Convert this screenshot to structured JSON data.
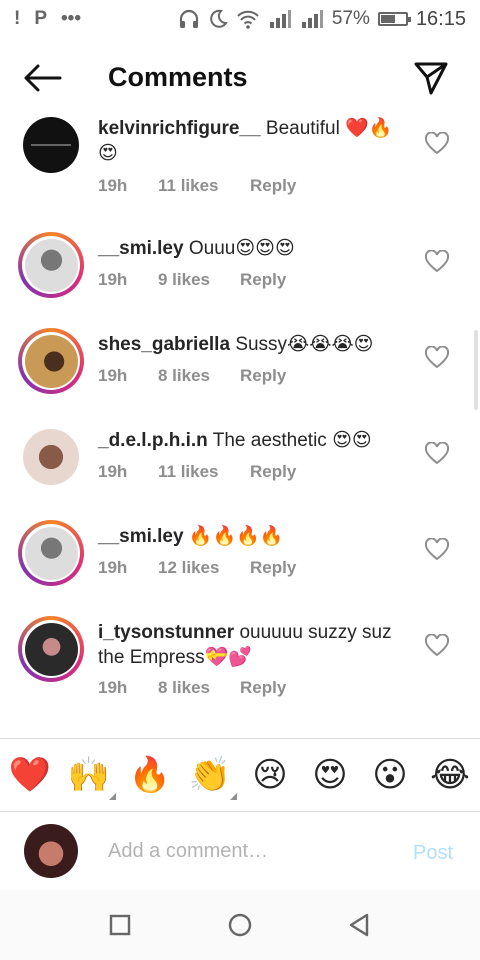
{
  "status_bar": {
    "left_glyphs": [
      "!",
      "P",
      "•••"
    ],
    "battery_percent": "57%",
    "battery_level": 0.57,
    "time": "16:15",
    "icons": [
      "headphones-icon",
      "moon-icon",
      "wifi-icon",
      "signal-icon",
      "signal-icon"
    ]
  },
  "header": {
    "title": "Comments",
    "back_icon": "back-arrow-icon",
    "send_icon": "direct-send-icon"
  },
  "comments": [
    {
      "username": "kelvinrichfigure__",
      "text": "Beautiful ❤️🔥😍",
      "time": "19h",
      "likes": "11 likes",
      "reply": "Reply",
      "has_story_ring": false
    },
    {
      "username": "__smi.ley",
      "text": "Ouuu😍😍😍",
      "time": "19h",
      "likes": "9 likes",
      "reply": "Reply",
      "has_story_ring": true
    },
    {
      "username": "shes_gabriella",
      "text": "Sussy😭😭😭😍",
      "time": "19h",
      "likes": "8 likes",
      "reply": "Reply",
      "has_story_ring": true
    },
    {
      "username": "_d.e.l.p.h.i.n",
      "text": "The aesthetic 😍😍",
      "time": "19h",
      "likes": "11 likes",
      "reply": "Reply",
      "has_story_ring": false
    },
    {
      "username": "__smi.ley",
      "text": "🔥🔥🔥🔥",
      "time": "19h",
      "likes": "12 likes",
      "reply": "Reply",
      "has_story_ring": true
    },
    {
      "username": "i_tysonstunner",
      "text": "ouuuuu suzzy suz the Empress💝💕",
      "time": "19h",
      "likes": "8 likes",
      "reply": "Reply",
      "has_story_ring": true
    }
  ],
  "emoji_bar": [
    "❤️",
    "🙌",
    "🔥",
    "👏",
    "😢",
    "😍",
    "😮",
    "😂"
  ],
  "composer": {
    "placeholder": "Add a comment…",
    "post_label": "Post"
  },
  "nav_bar": {
    "icons": [
      "recents-square-icon",
      "home-circle-icon",
      "back-triangle-icon"
    ]
  },
  "colors": {
    "accent": "#0095f6",
    "post_disabled": "#b2dffc",
    "meta_gray": "#8e8e8e",
    "text": "#262626",
    "emoji_heart": "#e0245e"
  }
}
